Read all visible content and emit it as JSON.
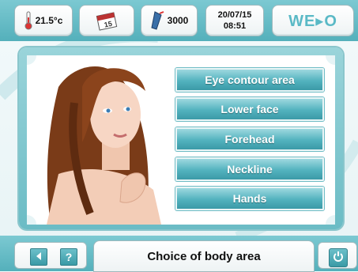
{
  "header": {
    "temperature": "21.5°c",
    "counter": "3000",
    "date": "20/07/15",
    "time": "08:51",
    "logo": "WE▸O",
    "calendar_icon_label": "15"
  },
  "menu": {
    "buttons": [
      {
        "label": "Eye contour area"
      },
      {
        "label": "Lower face"
      },
      {
        "label": "Forehead"
      },
      {
        "label": "Neckline"
      },
      {
        "label": "Hands"
      }
    ]
  },
  "footer": {
    "back_icon": "left-arrow",
    "help_label": "?",
    "status": "Choice of body area",
    "power_icon": "power"
  },
  "colors": {
    "accent": "#54b0bb",
    "button": "#3b9aa7"
  }
}
